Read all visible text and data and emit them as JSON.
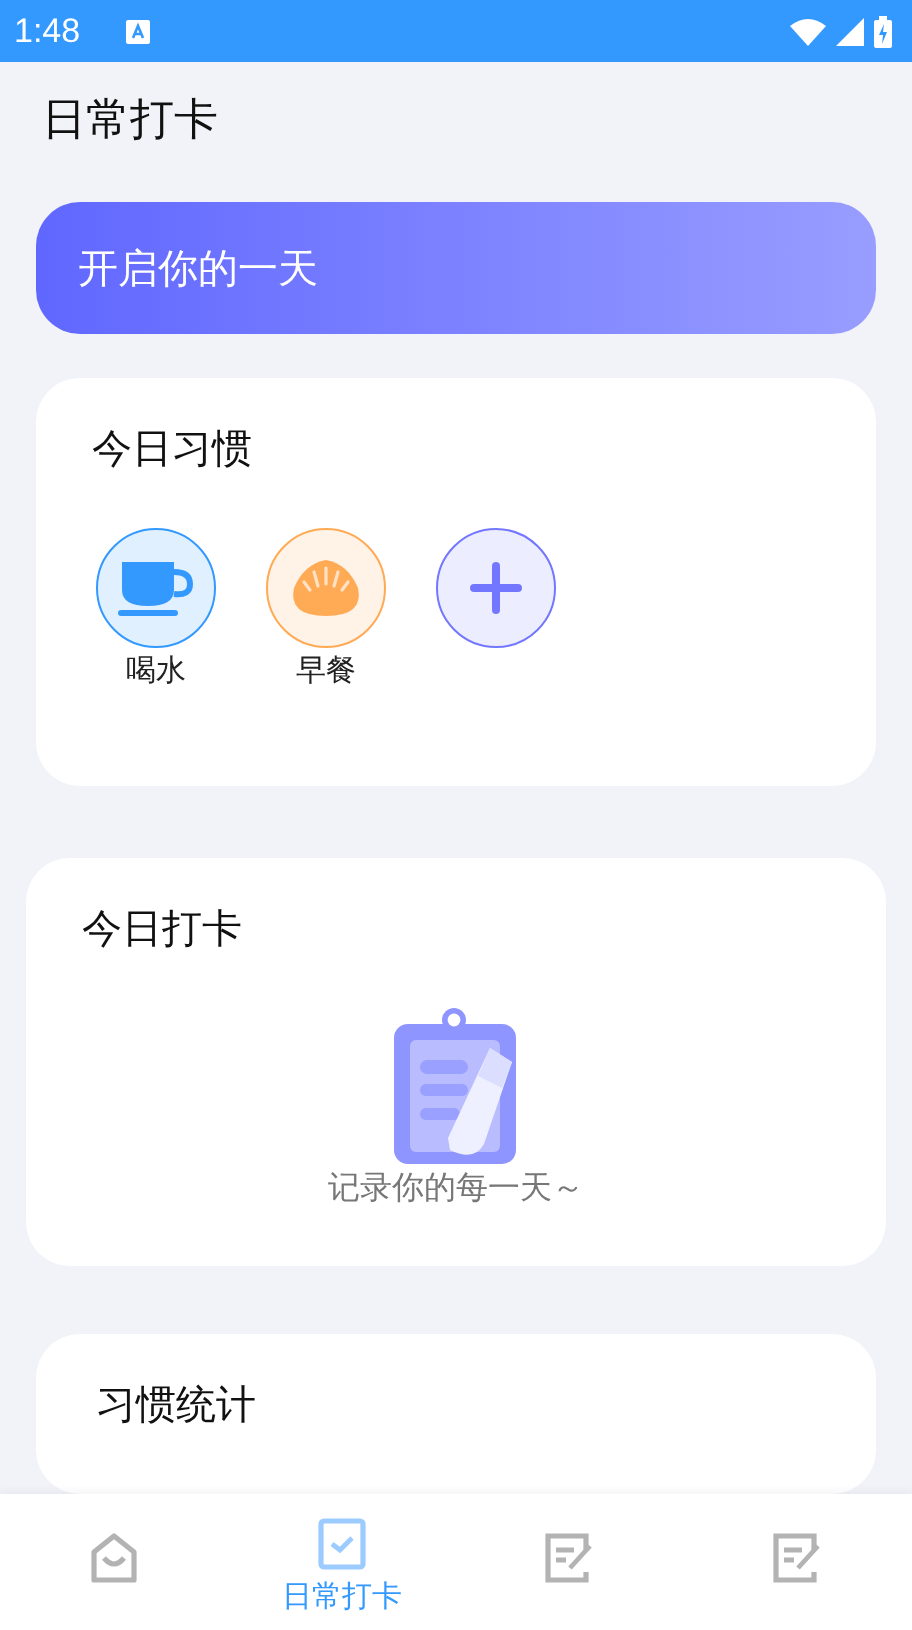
{
  "status_bar": {
    "time": "1:48"
  },
  "title": "日常打卡",
  "banner": {
    "text": "开启你的一天"
  },
  "habits": {
    "title": "今日习惯",
    "items": [
      {
        "kind": "cup",
        "label": "喝水",
        "color": "#3399ff"
      },
      {
        "kind": "bun",
        "label": "早餐",
        "color": "#ffaa55"
      }
    ]
  },
  "checkin": {
    "title": "今日打卡",
    "empty_text": "记录你的每一天～"
  },
  "stats": {
    "title": "习惯统计"
  },
  "tabs": [
    {
      "kind": "home",
      "selected": false
    },
    {
      "kind": "check",
      "label": "日常打卡",
      "selected": true
    },
    {
      "kind": "edit",
      "selected": false
    },
    {
      "kind": "edit",
      "selected": false
    }
  ]
}
